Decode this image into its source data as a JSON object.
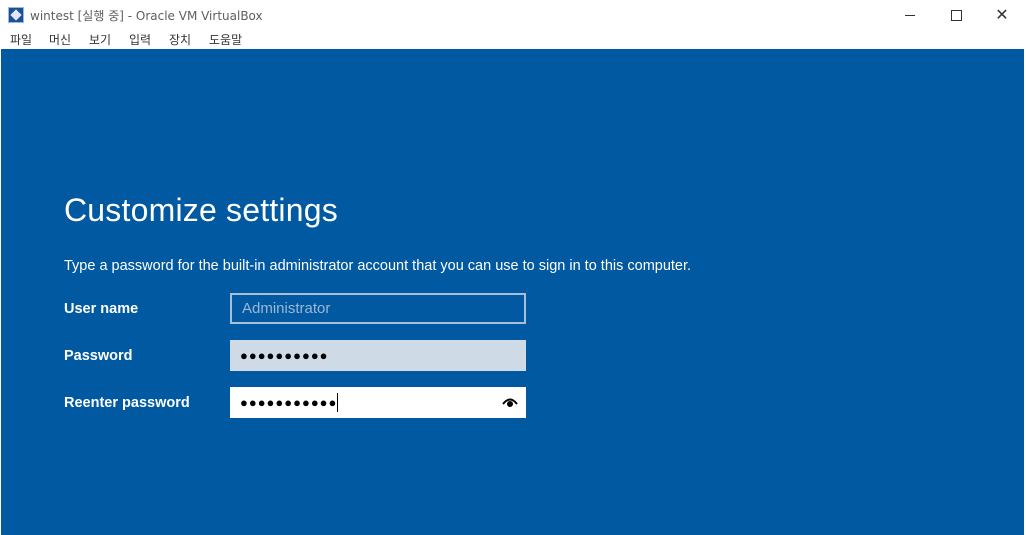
{
  "window": {
    "title": "wintest [실행 중] - Oracle VM VirtualBox",
    "app_icon": "virtualbox-icon",
    "controls": {
      "minimize": "minimize-icon",
      "maximize": "maximize-icon",
      "close": "close-icon",
      "close_glyph": "✕"
    }
  },
  "menu": {
    "items": [
      {
        "label": "파일"
      },
      {
        "label": "머신"
      },
      {
        "label": "보기"
      },
      {
        "label": "입력"
      },
      {
        "label": "장치"
      },
      {
        "label": "도움말"
      }
    ]
  },
  "setup": {
    "heading": "Customize settings",
    "description": "Type a password for the built-in administrator account that you can use to sign in to this computer.",
    "fields": {
      "user_name": {
        "label": "User name",
        "placeholder": "Administrator"
      },
      "password": {
        "label": "Password",
        "value": "●●●●●●●●●●"
      },
      "reenter_password": {
        "label": "Reenter password",
        "value": "●●●●●●●●●●●",
        "reveal_icon": "eye-icon"
      }
    }
  },
  "colors": {
    "background": "#0059a1",
    "text": "#ffffff"
  }
}
